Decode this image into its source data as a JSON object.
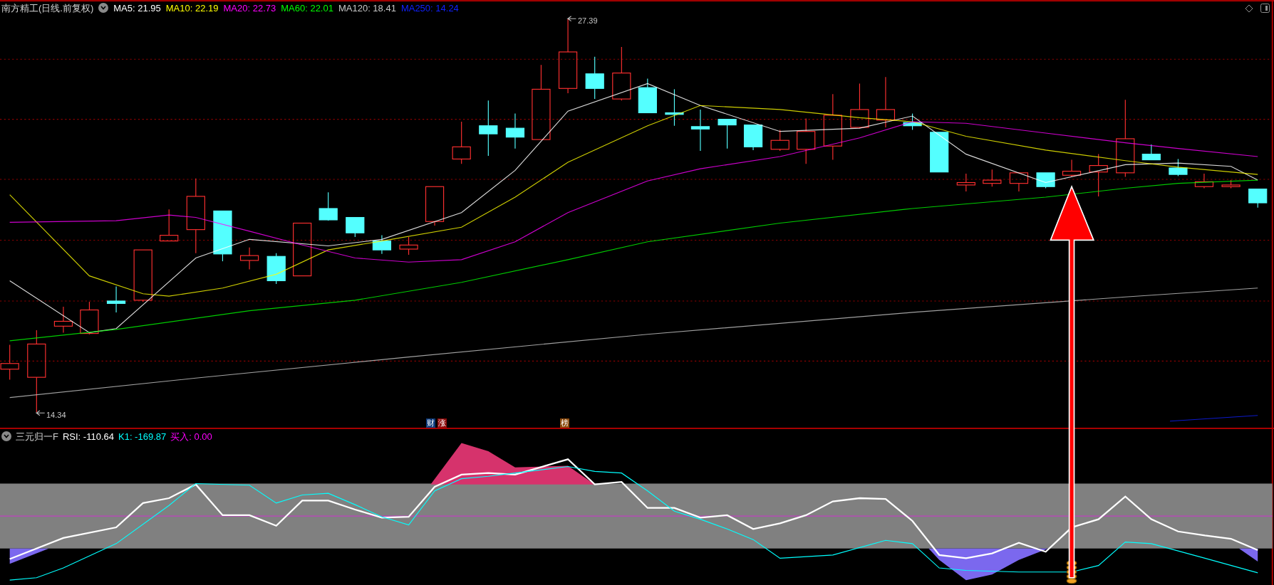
{
  "chart": {
    "title": "南方精工(日线.前复权)",
    "ma_legend": [
      {
        "label": "MA5: 21.95",
        "color": "#ffffff"
      },
      {
        "label": "MA10: 22.19",
        "color": "#ffff00"
      },
      {
        "label": "MA20: 22.73",
        "color": "#ff00ff"
      },
      {
        "label": "MA60: 22.01",
        "color": "#00ff00"
      },
      {
        "label": "MA120: 18.41",
        "color": "#c8c8c8"
      },
      {
        "label": "MA250: 14.24",
        "color": "#1020ff"
      }
    ],
    "high_label": "27.39",
    "low_label": "14.34",
    "event_badges": [
      {
        "text": "财",
        "color": "#0d3b7a"
      },
      {
        "text": "涨",
        "color": "#8b0a0a"
      },
      {
        "text": "榜",
        "color": "#8b4a0c"
      }
    ]
  },
  "indicator": {
    "title": "三元归一F",
    "values": [
      {
        "label": "RSI: -110.64",
        "color": "#ffffff"
      },
      {
        "label": "K1: -169.87",
        "color": "#00ffff"
      },
      {
        "label": "买入: 0.00",
        "color": "#ff00ff"
      }
    ]
  }
}
